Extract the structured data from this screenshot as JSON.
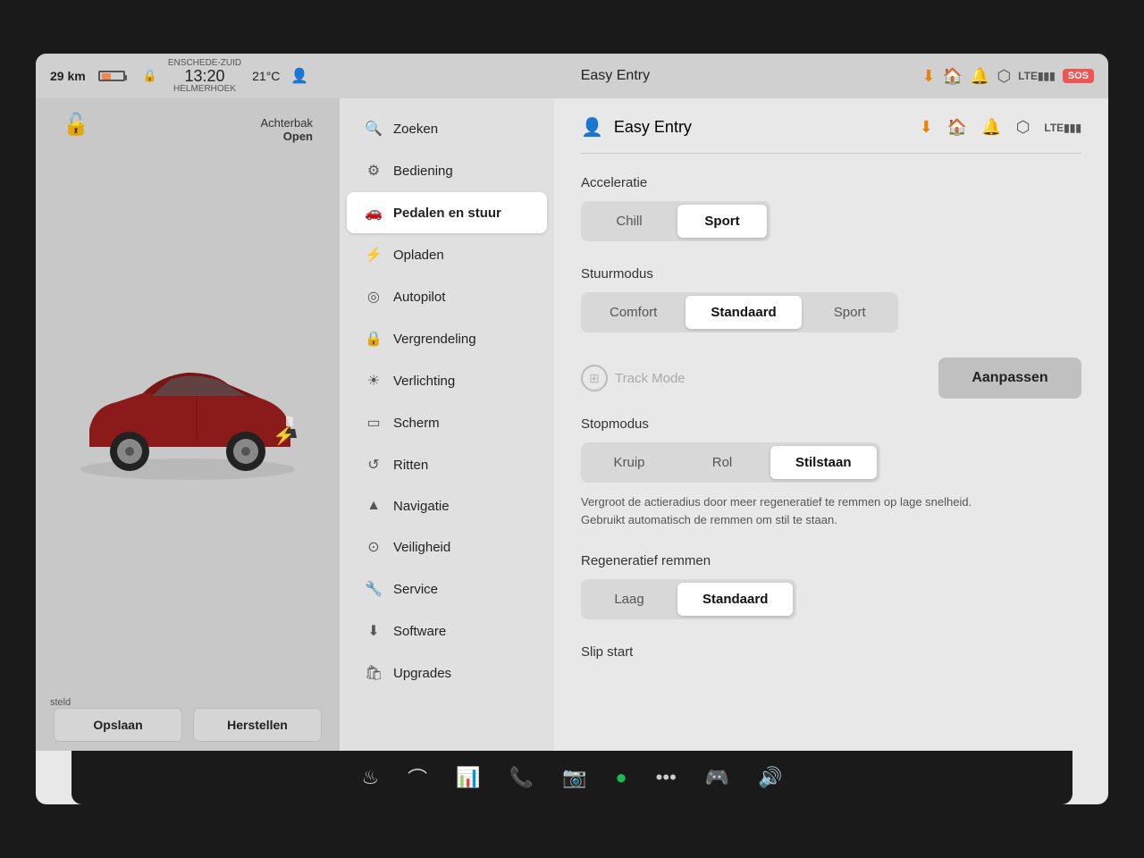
{
  "status_bar": {
    "km": "29 km",
    "location": "ENSCHEDE-ZUID",
    "time": "13:20",
    "temperature": "21°C",
    "helmerhoek": "HELMERHOEK",
    "title": "Easy Entry",
    "sos": "SOS"
  },
  "car_panel": {
    "trunk_label": "Achterbak",
    "trunk_status": "Open",
    "save_button": "Opslaan",
    "reset_button": "Herstellen",
    "status_text": "steld"
  },
  "nav": {
    "items": [
      {
        "id": "zoeken",
        "label": "Zoeken",
        "icon": "🔍"
      },
      {
        "id": "bediening",
        "label": "Bediening",
        "icon": "⚙"
      },
      {
        "id": "pedalen",
        "label": "Pedalen en stuur",
        "icon": "🚗",
        "active": true
      },
      {
        "id": "opladen",
        "label": "Opladen",
        "icon": "⚡"
      },
      {
        "id": "autopilot",
        "label": "Autopilot",
        "icon": "◎"
      },
      {
        "id": "vergrendeling",
        "label": "Vergrendeling",
        "icon": "🔒"
      },
      {
        "id": "verlichting",
        "label": "Verlichting",
        "icon": "☀"
      },
      {
        "id": "scherm",
        "label": "Scherm",
        "icon": "▭"
      },
      {
        "id": "ritten",
        "label": "Ritten",
        "icon": "↺"
      },
      {
        "id": "navigatie",
        "label": "Navigatie",
        "icon": "▲"
      },
      {
        "id": "veiligheid",
        "label": "Veiligheid",
        "icon": "⊙"
      },
      {
        "id": "service",
        "label": "Service",
        "icon": "🔧"
      },
      {
        "id": "software",
        "label": "Software",
        "icon": "⬇"
      },
      {
        "id": "upgrades",
        "label": "Upgrades",
        "icon": "🛍"
      }
    ]
  },
  "content": {
    "profile_name": "Easy Entry",
    "sections": {
      "acceleratie": {
        "title": "Acceleratie",
        "options": [
          "Chill",
          "Sport"
        ],
        "active": "Sport"
      },
      "stuurmodus": {
        "title": "Stuurmodus",
        "options": [
          "Comfort",
          "Standaard",
          "Sport"
        ],
        "active": "Standaard"
      },
      "track_mode": {
        "label": "Track Mode",
        "button": "Aanpassen"
      },
      "stopmodus": {
        "title": "Stopmodus",
        "options": [
          "Kruip",
          "Rol",
          "Stilstaan"
        ],
        "active": "Stilstaan",
        "description": "Vergroot de actieradius door meer regeneratief te remmen op lage snelheid. Gebruikt automatisch de remmen om stil te staan."
      },
      "regeneratief": {
        "title": "Regeneratief remmen",
        "options": [
          "Laag",
          "Standaard"
        ],
        "active": "Standaard"
      },
      "slip_start": {
        "title": "Slip start"
      }
    }
  },
  "taskbar": {
    "icons": [
      "heat",
      "wiper",
      "chart",
      "phone",
      "camera",
      "spotify",
      "more",
      "games",
      "volume"
    ]
  }
}
